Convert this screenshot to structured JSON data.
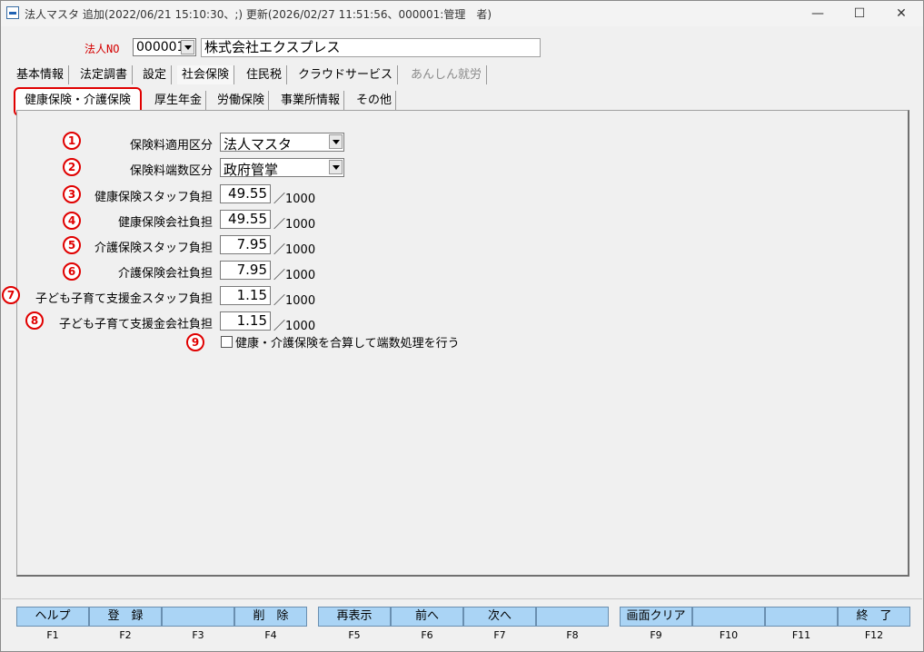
{
  "window": {
    "title": "法人マスタ 追加(2022/06/21 15:10:30、;) 更新(2026/02/27 11:51:56、000001:管理　者)",
    "min": "—",
    "max": "☐",
    "close": "✕"
  },
  "corp": {
    "label": "法人NO",
    "number": "000001",
    "name": "株式会社エクスプレス"
  },
  "tabs": [
    {
      "label": "基本情報"
    },
    {
      "label": "法定調書"
    },
    {
      "label": "設定"
    },
    {
      "label": "社会保険"
    },
    {
      "label": "住民税"
    },
    {
      "label": "クラウドサービス"
    },
    {
      "label": "あんしん就労"
    }
  ],
  "subtabs": [
    {
      "label": "健康保険・介護保険"
    },
    {
      "label": "厚生年金"
    },
    {
      "label": "労働保険"
    },
    {
      "label": "事業所情報"
    },
    {
      "label": "その他"
    }
  ],
  "fields": [
    {
      "num": "1",
      "label": "保険料適用区分",
      "value": "法人マスタ"
    },
    {
      "num": "2",
      "label": "保険料端数区分",
      "value": "政府管掌"
    },
    {
      "num": "3",
      "label": "健康保険スタッフ負担",
      "value": "49.55",
      "unit": "／1000"
    },
    {
      "num": "4",
      "label": "健康保険会社負担",
      "value": "49.55",
      "unit": "／1000"
    },
    {
      "num": "5",
      "label": "介護保険スタッフ負担",
      "value": "7.95",
      "unit": "／1000"
    },
    {
      "num": "6",
      "label": "介護保険会社負担",
      "value": "7.95",
      "unit": "／1000"
    },
    {
      "num": "7",
      "label": "子ども子育て支援金スタッフ負担",
      "value": "1.15",
      "unit": "／1000"
    },
    {
      "num": "8",
      "label": "子ども子育て支援金会社負担",
      "value": "1.15",
      "unit": "／1000"
    }
  ],
  "checkbox": {
    "num": "9",
    "label": "健康・介護保険を合算して端数処理を行う"
  },
  "fkeys": [
    {
      "label": "ヘルプ",
      "key": "F1"
    },
    {
      "label": "登　録",
      "key": "F2"
    },
    {
      "label": "",
      "key": "F3"
    },
    {
      "label": "削　除",
      "key": "F4"
    },
    {
      "label": "再表示",
      "key": "F5"
    },
    {
      "label": "前へ",
      "key": "F6"
    },
    {
      "label": "次へ",
      "key": "F7"
    },
    {
      "label": "",
      "key": "F8"
    },
    {
      "label": "画面クリア",
      "key": "F9"
    },
    {
      "label": "",
      "key": "F10"
    },
    {
      "label": "",
      "key": "F11"
    },
    {
      "label": "終　了",
      "key": "F12"
    }
  ],
  "colors": {
    "accent_red": "#e00000",
    "fkey_bg": "#aad4f5"
  }
}
